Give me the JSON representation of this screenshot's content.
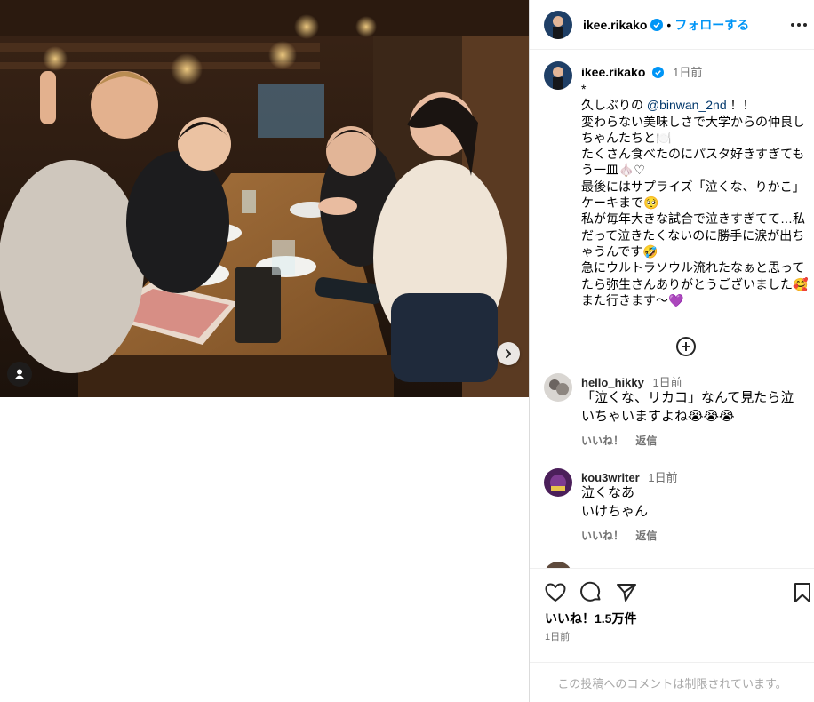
{
  "photo": {
    "description_icon": "user-tag-icon",
    "next_icon": "chevron-right-icon"
  },
  "header": {
    "username": "ikee.rikako",
    "follow_label": "フォローする",
    "more_icon": "more-horizontal-icon"
  },
  "caption": {
    "username": "ikee.rikako",
    "time": "1日前",
    "lines": {
      "l0": "*",
      "l1a": "久しぶりの ",
      "l1_mention": "@binwan_2nd",
      "l1b": " ！！",
      "l2": "変わらない美味しさで大学からの仲良しちゃんたちと🍽️",
      "l3": "たくさん食べたのにパスタ好きすぎてもう一皿🧄♡",
      "l4": "最後にはサプライズ「泣くな、りかこ」ケーキまで🥺",
      "l5": "私が毎年大きな試合で泣きすぎてて…私だって泣きたくないのに勝手に涙が出ちゃうんです🤣",
      "l6": "急にウルトラソウル流れたなぁと思ってたら弥生さんありがとうございました🥰 また行きます〜💜"
    },
    "load_more_icon": "plus-circle-icon"
  },
  "comments": [
    {
      "username": "hello_hikky",
      "time": "1日前",
      "text": "「泣くな、リカコ」なんて見たら泣いちゃいますよね😭😭😭",
      "like_label": "いいね！",
      "reply_label": "返信"
    },
    {
      "username": "kou3writer",
      "time": "1日前",
      "line1": "泣くなあ",
      "line2": "いけちゃん",
      "like_label": "いいね！",
      "reply_label": "返信"
    }
  ],
  "actions": {
    "like_icon": "heart-icon",
    "comment_icon": "comment-icon",
    "share_icon": "send-icon",
    "save_icon": "bookmark-icon",
    "likes_text": "いいね！1.5万件",
    "posted_time": "1日前"
  },
  "comment_box": {
    "restricted_text": "この投稿へのコメントは制限されています。"
  },
  "colors": {
    "link_blue": "#0095f6",
    "mention": "#00376b",
    "muted": "#737373",
    "border": "#dbdbdb"
  }
}
